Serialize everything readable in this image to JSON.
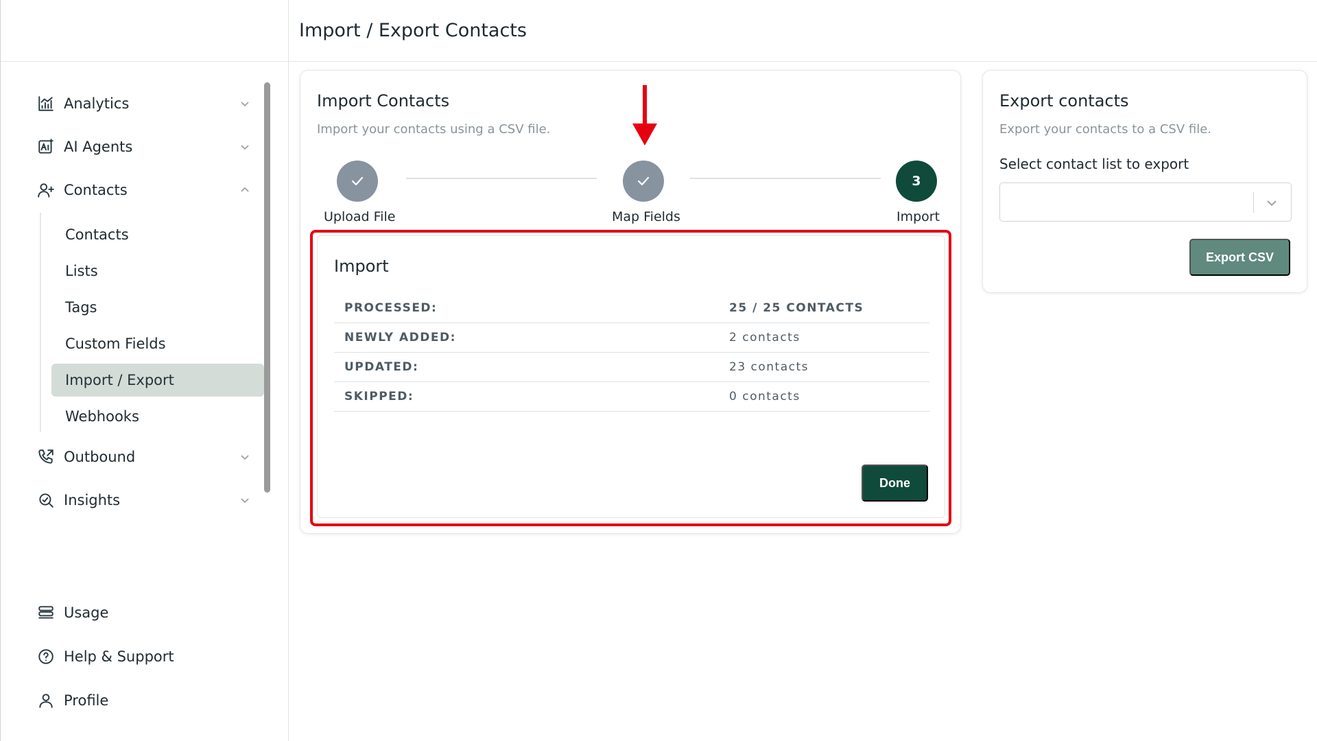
{
  "header": {
    "title": "Import / Export Contacts"
  },
  "sidebar": {
    "items": [
      {
        "label": "Analytics",
        "icon": "analytics-icon"
      },
      {
        "label": "AI Agents",
        "icon": "ai-agents-icon"
      },
      {
        "label": "Contacts",
        "icon": "user-plus-icon"
      },
      {
        "label": "Outbound",
        "icon": "phone-outgoing-icon"
      },
      {
        "label": "Insights",
        "icon": "insights-icon"
      }
    ],
    "contacts_sub": [
      "Contacts",
      "Lists",
      "Tags",
      "Custom Fields",
      "Import / Export",
      "Webhooks"
    ],
    "active_sub": "Import / Export",
    "footer": [
      {
        "label": "Usage",
        "icon": "usage-icon"
      },
      {
        "label": "Help & Support",
        "icon": "help-icon"
      },
      {
        "label": "Profile",
        "icon": "profile-icon"
      }
    ]
  },
  "import_card": {
    "title": "Import Contacts",
    "subtitle": "Import your contacts using a CSV file.",
    "steps": [
      {
        "label": "Upload File",
        "state": "done"
      },
      {
        "label": "Map Fields",
        "state": "done"
      },
      {
        "label": "Import",
        "state": "current",
        "number": "3"
      }
    ],
    "panel": {
      "title": "Import",
      "rows": [
        {
          "key": "PROCESSED:",
          "value": "25 / 25 CONTACTS"
        },
        {
          "key": "NEWLY ADDED:",
          "value": "2 contacts"
        },
        {
          "key": "UPDATED:",
          "value": "23 contacts"
        },
        {
          "key": "SKIPPED:",
          "value": "0 contacts"
        }
      ],
      "done_label": "Done"
    }
  },
  "export_card": {
    "title": "Export contacts",
    "subtitle": "Export your contacts to a CSV file.",
    "select_label": "Select contact list to export",
    "select_value": "",
    "button_label": "Export CSV"
  },
  "colors": {
    "primary": "#0f4a3a",
    "export_button": "#5f8a7d",
    "step_done": "#8893a0",
    "highlight": "#e60012",
    "active_nav_bg": "#d4dcd8"
  }
}
